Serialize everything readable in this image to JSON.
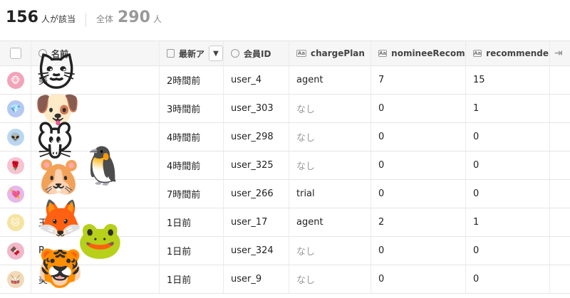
{
  "summary": {
    "count": "156",
    "count_unit": "人が該当",
    "total_label": "全体",
    "total": "290",
    "total_unit": "人"
  },
  "columns": [
    {
      "label": "名前",
      "icon": "person-icon"
    },
    {
      "label": "最新ア",
      "icon": "calendar-icon"
    },
    {
      "label": "会員ID",
      "icon": "person-icon"
    },
    {
      "label": "chargePlan",
      "icon": "text-field-icon"
    },
    {
      "label": "nomineeRecom…",
      "icon": "text-field-icon"
    },
    {
      "label": "recommende…",
      "icon": "text-field-icon"
    }
  ],
  "rows": [
    {
      "name": "美",
      "avatar_color": "#f3a3b8",
      "avatar_icon": "🐵",
      "last": "2時間前",
      "id": "user_4",
      "plan": "agent",
      "plan_muted": false,
      "nominee": "7",
      "recommended": "15"
    },
    {
      "name": "",
      "avatar_color": "#b4c8f2",
      "avatar_icon": "💎",
      "last": "3時間前",
      "id": "user_303",
      "plan": "なし",
      "plan_muted": true,
      "nominee": "0",
      "recommended": "1"
    },
    {
      "name": "",
      "avatar_color": "#b9d7f1",
      "avatar_icon": "👽",
      "last": "4時間前",
      "id": "user_298",
      "plan": "なし",
      "plan_muted": true,
      "nominee": "0",
      "recommended": "0"
    },
    {
      "name": "",
      "avatar_color": "#f6c3d0",
      "avatar_icon": "🌹",
      "last": "4時間前",
      "id": "user_325",
      "plan": "なし",
      "plan_muted": true,
      "nominee": "0",
      "recommended": "0"
    },
    {
      "name": "",
      "avatar_color": "#e6b8e8",
      "avatar_icon": "💘",
      "last": "7時間前",
      "id": "user_266",
      "plan": "trial",
      "plan_muted": false,
      "nominee": "0",
      "recommended": "0"
    },
    {
      "name": "玉",
      "avatar_color": "#f5e3a0",
      "avatar_icon": "🐱",
      "last": "1日前",
      "id": "user_17",
      "plan": "agent",
      "plan_muted": false,
      "nominee": "2",
      "recommended": "1"
    },
    {
      "name": "R",
      "avatar_color": "#f0b8c8",
      "avatar_icon": "🍫",
      "last": "1日前",
      "id": "user_324",
      "plan": "なし",
      "plan_muted": true,
      "nominee": "0",
      "recommended": "0"
    },
    {
      "name": "美",
      "avatar_color": "#f2d9b8",
      "avatar_icon": "🥁",
      "last": "1日前",
      "id": "user_9",
      "plan": "なし",
      "plan_muted": true,
      "nominee": "0",
      "recommended": "0"
    }
  ],
  "overlay_emojis": [
    "🐱",
    "🐶",
    "🐭",
    "🐧",
    "🐹",
    "🦊",
    "🐸",
    "🐯"
  ]
}
